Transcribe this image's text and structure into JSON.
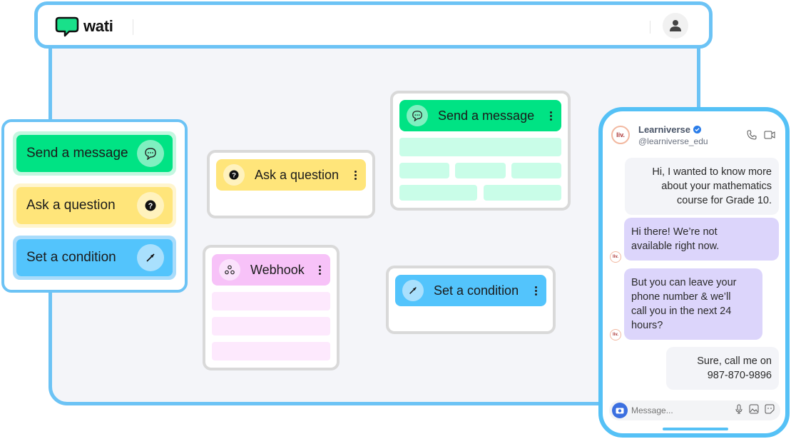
{
  "app": {
    "brand": "wati"
  },
  "header": {
    "account_icon": "user-icon"
  },
  "palette": {
    "items": [
      {
        "label": "Send a message",
        "icon": "chat-bubble-icon",
        "color": "#00e384"
      },
      {
        "label": "Ask a question",
        "icon": "question-icon",
        "color": "#ffe57a"
      },
      {
        "label": "Set a condition",
        "icon": "compass-arrow-icon",
        "color": "#53c4fc"
      }
    ]
  },
  "flow": {
    "nodes": [
      {
        "id": "ask",
        "label": "Ask a question",
        "icon": "question-icon",
        "color": "#ffe57a"
      },
      {
        "id": "webhook",
        "label": "Webhook",
        "icon": "webhook-icon",
        "color": "#f7c2f8"
      },
      {
        "id": "send",
        "label": "Send a message",
        "icon": "chat-bubble-icon",
        "color": "#00e384"
      },
      {
        "id": "condition",
        "label": "Set a condition",
        "icon": "compass-arrow-icon",
        "color": "#53c4fc"
      }
    ],
    "connections": [
      {
        "from": "ask",
        "to": "send"
      },
      {
        "from": "ask",
        "to": "webhook"
      },
      {
        "from": "webhook",
        "to": "condition"
      }
    ]
  },
  "chat": {
    "contact_name": "Learniverse",
    "contact_handle": "@learniverse_edu",
    "avatar_text": "liv.",
    "verified": true,
    "messages": [
      {
        "direction": "outgoing",
        "lines": [
          "Hi, I wanted to know more",
          "about your mathematics",
          "course for Grade 10."
        ]
      },
      {
        "direction": "incoming",
        "lines": [
          "Hi there! We’re not",
          "available right now."
        ]
      },
      {
        "direction": "incoming",
        "lines": [
          "But you can leave your",
          "phone number & we’ll",
          "call you in the next 24",
          "hours?"
        ]
      },
      {
        "direction": "outgoing",
        "lines": [
          "Sure, call me on",
          "987-870-9896"
        ]
      }
    ],
    "composer": {
      "placeholder": "Message..."
    }
  },
  "colors": {
    "frame_accent": "#6cc3f5",
    "phone_accent": "#55c1f6",
    "canvas_bg": "#f4f5f9"
  }
}
